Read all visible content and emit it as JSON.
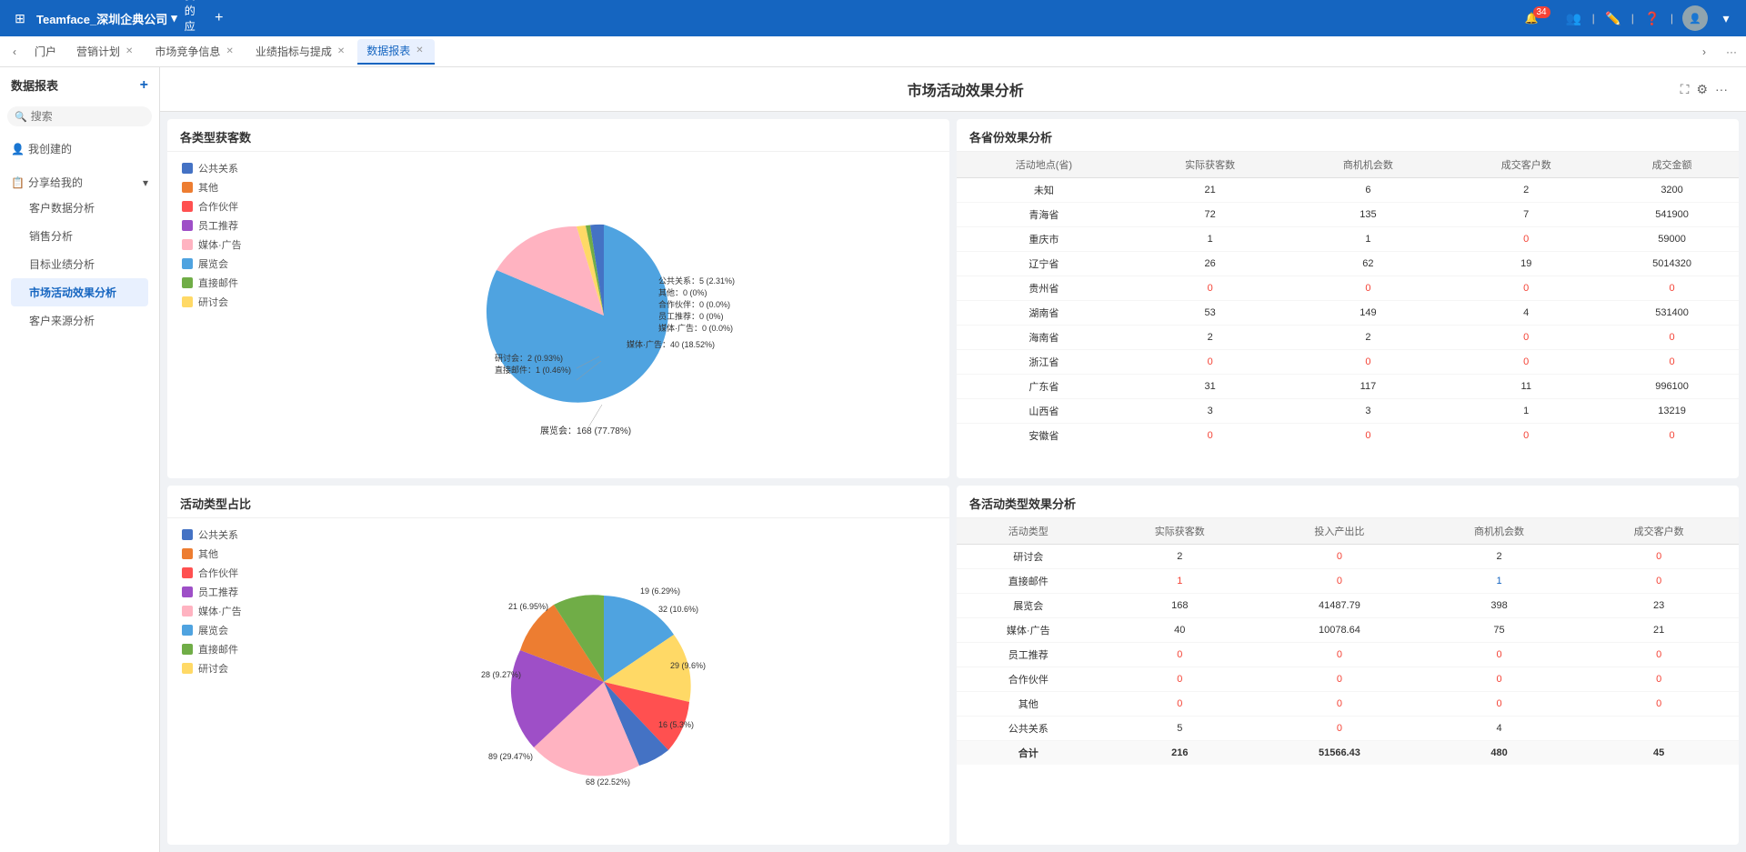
{
  "topnav": {
    "brand": "Teamface_深圳企典公司",
    "myapps": "我的应用",
    "notification_count": "34"
  },
  "tabs": [
    {
      "label": "门户",
      "closable": false,
      "active": false
    },
    {
      "label": "营销计划",
      "closable": true,
      "active": false
    },
    {
      "label": "市场竞争信息",
      "closable": true,
      "active": false
    },
    {
      "label": "业绩指标与提成",
      "closable": true,
      "active": false
    },
    {
      "label": "数据报表",
      "closable": true,
      "active": true
    }
  ],
  "sidebar": {
    "title": "数据报表",
    "search_placeholder": "搜索",
    "my_created": "我创建的",
    "shared_with_me": "分享给我的",
    "nav_items": [
      "客户数据分析",
      "销售分析",
      "目标业绩分析",
      "市场活动效果分析",
      "客户来源分析"
    ]
  },
  "page": {
    "title": "市场活动效果分析"
  },
  "panel1": {
    "title": "各类型获客数",
    "legend": [
      {
        "name": "公共关系",
        "color": "#4472c4"
      },
      {
        "name": "其他",
        "color": "#ed7d31"
      },
      {
        "name": "合作伙伴",
        "color": "#ff5050"
      },
      {
        "name": "员工推荐",
        "color": "#9e4fc7"
      },
      {
        "name": "媒体·广告",
        "color": "#ffb3c1"
      },
      {
        "name": "展览会",
        "color": "#4fa3e0"
      },
      {
        "name": "直接邮件",
        "color": "#70ad47"
      },
      {
        "name": "研讨会",
        "color": "#ffd966"
      }
    ],
    "pie_slices": [
      {
        "name": "展览会",
        "value": 168,
        "pct": "77.78%",
        "color": "#4fa3e0",
        "start": 0,
        "end": 280
      },
      {
        "name": "媒体·广告",
        "value": 40,
        "pct": "18.52%",
        "color": "#ffb3c1",
        "start": 280,
        "end": 347
      },
      {
        "name": "研讨会",
        "value": 2,
        "pct": "0.93%",
        "color": "#ffd966",
        "start": 347,
        "end": 350
      },
      {
        "name": "直接邮件",
        "value": 1,
        "pct": "0.46%",
        "color": "#70ad47",
        "start": 350,
        "end": 352
      },
      {
        "name": "公共关系",
        "value": 5,
        "pct": "2.31%",
        "color": "#4472c4",
        "start": 352,
        "end": 360
      },
      {
        "name": "其他",
        "value": 0,
        "pct": "0%",
        "color": "#ed7d31",
        "start": 0,
        "end": 0
      },
      {
        "name": "合作伙伴",
        "value": 0,
        "pct": "0%",
        "color": "#ff5050",
        "start": 0,
        "end": 0
      },
      {
        "name": "员工推荐",
        "value": 0,
        "pct": "0%",
        "color": "#9e4fc7",
        "start": 0,
        "end": 0
      }
    ]
  },
  "panel2": {
    "title": "各省份效果分析",
    "headers": [
      "活动地点(省)",
      "实际获客数",
      "商机机会数",
      "成交客户数",
      "成交金额"
    ],
    "rows": [
      [
        "未知",
        "21",
        "6",
        "2",
        "3200"
      ],
      [
        "青海省",
        "72",
        "135",
        "7",
        "541900"
      ],
      [
        "重庆市",
        "1",
        "1",
        "0",
        "59000"
      ],
      [
        "辽宁省",
        "26",
        "62",
        "19",
        "5014320"
      ],
      [
        "贵州省",
        "0",
        "0",
        "0",
        "0"
      ],
      [
        "湖南省",
        "53",
        "149",
        "4",
        "531400"
      ],
      [
        "海南省",
        "2",
        "2",
        "0",
        "0"
      ],
      [
        "浙江省",
        "0",
        "0",
        "0",
        "0"
      ],
      [
        "广东省",
        "31",
        "117",
        "11",
        "996100"
      ],
      [
        "山西省",
        "3",
        "3",
        "1",
        "13219"
      ],
      [
        "安徽省",
        "0",
        "0",
        "0",
        "0"
      ]
    ]
  },
  "panel3": {
    "title": "活动类型占比",
    "legend": [
      {
        "name": "公共关系",
        "color": "#4472c4"
      },
      {
        "name": "其他",
        "color": "#ed7d31"
      },
      {
        "name": "合作伙伴",
        "color": "#ff5050"
      },
      {
        "name": "员工推荐",
        "color": "#9e4fc7"
      },
      {
        "name": "媒体·广告",
        "color": "#ffb3c1"
      },
      {
        "name": "展览会",
        "color": "#4fa3e0"
      },
      {
        "name": "直接邮件",
        "color": "#70ad47"
      },
      {
        "name": "研讨会",
        "color": "#ffd966"
      }
    ]
  },
  "panel4": {
    "title": "各活动类型效果分析",
    "headers": [
      "活动类型",
      "实际获客数",
      "投入产出比",
      "商机机会数",
      "成交客户数"
    ],
    "rows": [
      [
        "研讨会",
        "2",
        "0",
        "2",
        "0"
      ],
      [
        "直接邮件",
        "1",
        "0",
        "1",
        "0"
      ],
      [
        "展览会",
        "168",
        "41487.79",
        "398",
        "23"
      ],
      [
        "媒体·广告",
        "40",
        "10078.64",
        "75",
        "21"
      ],
      [
        "员工推荐",
        "0",
        "0",
        "0",
        "0"
      ],
      [
        "合作伙伴",
        "0",
        "0",
        "0",
        "0"
      ],
      [
        "其他",
        "0",
        "0",
        "0",
        "0"
      ],
      [
        "公共关系",
        "5",
        "0",
        "4",
        ""
      ],
      [
        "合计",
        "216",
        "51566.43",
        "480",
        "45"
      ]
    ],
    "highlight_rows": [
      1,
      2
    ],
    "total_row": 8
  }
}
